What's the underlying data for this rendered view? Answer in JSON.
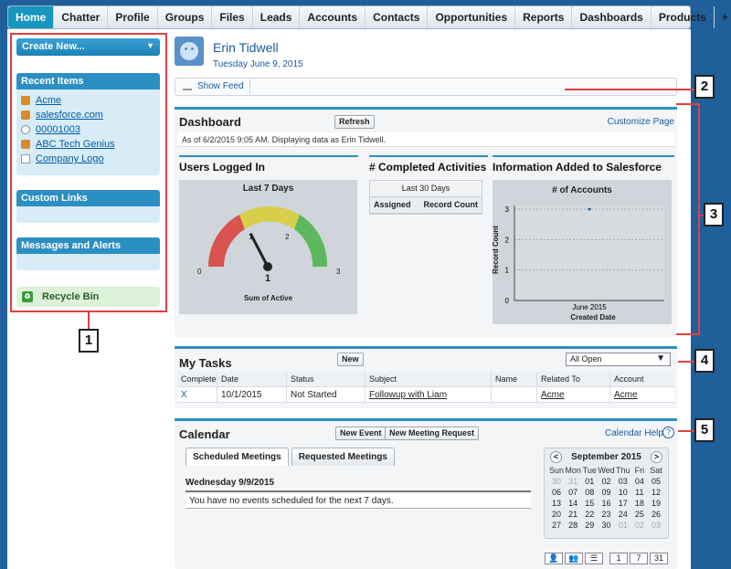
{
  "nav": {
    "tabs": [
      "Home",
      "Chatter",
      "Profile",
      "Groups",
      "Files",
      "Leads",
      "Accounts",
      "Contacts",
      "Opportunities",
      "Reports",
      "Dashboards",
      "Products"
    ],
    "plus": "+",
    "more": "▾"
  },
  "sidebar": {
    "create_new": "Create New...",
    "recent_items_title": "Recent Items",
    "recent_items": [
      "Acme",
      "salesforce.com",
      "00001003",
      "ABC Tech Genius",
      "Company Logo"
    ],
    "custom_links_title": "Custom Links",
    "messages_title": "Messages and Alerts",
    "recycle_bin": "Recycle Bin"
  },
  "user": {
    "name": "Erin Tidwell",
    "date": "Tuesday June 9, 2015"
  },
  "feed": {
    "show_feed": "Show Feed"
  },
  "dashboard": {
    "title": "Dashboard",
    "refresh": "Refresh",
    "customize": "Customize Page",
    "info": "As of 6/2/2015 9:05 AM. Displaying data as Erin Tidwell.",
    "users_title": "Users Logged In",
    "gauge_caption": "Last 7 Days",
    "gauge_min": "0",
    "gauge_t1": "1",
    "gauge_t2": "2",
    "gauge_max": "3",
    "gauge_value": "1",
    "gauge_value_num": 1,
    "gauge_label": "Sum of Active",
    "activities_title": "# Completed Activities",
    "activities_period": "Last 30 Days",
    "activities_col1": "Assigned",
    "activities_col2": "Record Count",
    "info_added_title": "Information Added to Salesforce"
  },
  "chart_data": {
    "type": "scatter",
    "title": "# of Accounts",
    "xlabel": "Created Date",
    "ylabel": "Record Count",
    "categories": [
      "June 2015"
    ],
    "values": [
      3
    ],
    "yticks": [
      "0",
      "1",
      "2",
      "3"
    ],
    "ylim": [
      0,
      3
    ]
  },
  "tasks": {
    "title": "My Tasks",
    "new": "New",
    "filter": "All Open",
    "columns": [
      "Complete",
      "Date",
      "Status",
      "Subject",
      "Name",
      "Related To",
      "Account"
    ],
    "rows": [
      {
        "complete": "X",
        "date": "10/1/2015",
        "status": "Not Started",
        "subject": "Followup with Liam",
        "name": "",
        "related": "Acme",
        "account": "Acme"
      }
    ]
  },
  "calendar": {
    "title": "Calendar",
    "new_event": "New Event",
    "new_meeting": "New Meeting Request",
    "help": "Calendar Help",
    "tabs": [
      "Scheduled Meetings",
      "Requested Meetings"
    ],
    "day": "Wednesday 9/9/2015",
    "empty": "You have no events scheduled for the next 7 days.",
    "month": "September 2015",
    "prev": "<",
    "next": ">",
    "dow": [
      "Sun",
      "Mon",
      "Tue",
      "Wed",
      "Thu",
      "Fri",
      "Sat"
    ],
    "weeks": [
      [
        "30",
        "31",
        "01",
        "02",
        "03",
        "04",
        "05"
      ],
      [
        "06",
        "07",
        "08",
        "09",
        "10",
        "11",
        "12"
      ],
      [
        "13",
        "14",
        "15",
        "16",
        "17",
        "18",
        "19"
      ],
      [
        "20",
        "21",
        "22",
        "23",
        "24",
        "25",
        "26"
      ],
      [
        "27",
        "28",
        "29",
        "30",
        "01",
        "02",
        "03"
      ]
    ],
    "views": [
      "1",
      "7",
      "31"
    ]
  },
  "callouts": [
    "1",
    "2",
    "3",
    "4",
    "5"
  ],
  "colors": {
    "accent": "#2c8fc3",
    "callout": "#e04040",
    "link": "#1a5aa0"
  }
}
